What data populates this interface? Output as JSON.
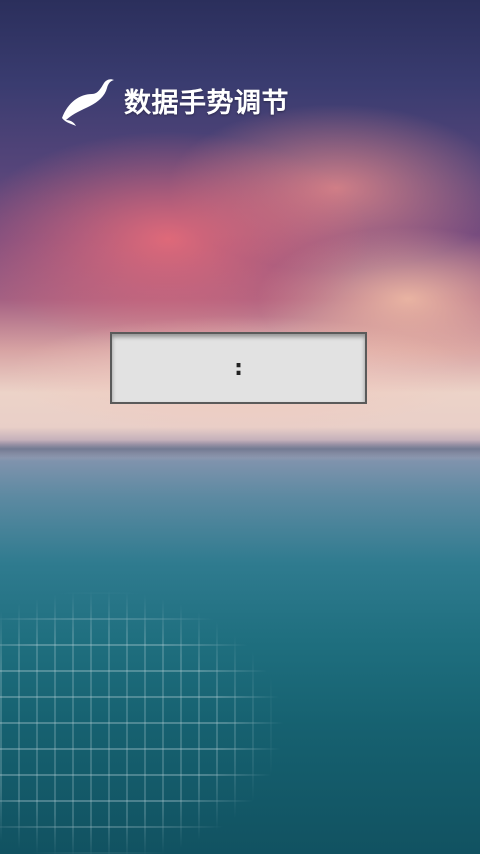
{
  "header": {
    "logo_icon": "swan-logo-icon",
    "title": "数据手势调节"
  },
  "time_display": {
    "value": ":"
  },
  "colors": {
    "title": "#ffffff",
    "box_background": "#e2e2e2",
    "box_border": "#5a5a5a"
  }
}
